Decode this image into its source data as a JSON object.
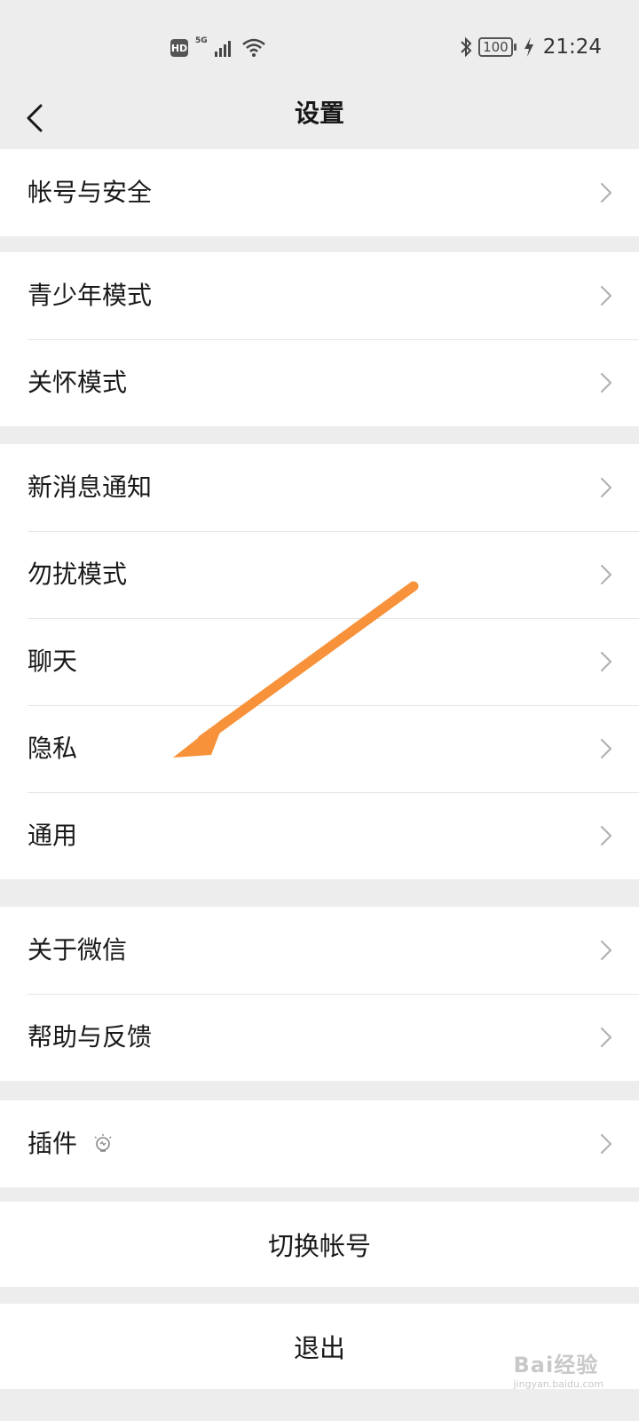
{
  "status_bar": {
    "hd": "HD",
    "network": "5G",
    "battery": "100",
    "time": "21:24"
  },
  "navbar": {
    "title": "设置"
  },
  "groups": [
    {
      "items": [
        {
          "label": "帐号与安全"
        }
      ]
    },
    {
      "items": [
        {
          "label": "青少年模式"
        },
        {
          "label": "关怀模式"
        }
      ]
    },
    {
      "items": [
        {
          "label": "新消息通知"
        },
        {
          "label": "勿扰模式"
        },
        {
          "label": "聊天"
        },
        {
          "label": "隐私"
        },
        {
          "label": "通用"
        }
      ]
    },
    {
      "items": [
        {
          "label": "关于微信"
        },
        {
          "label": "帮助与反馈"
        }
      ]
    },
    {
      "items": [
        {
          "label": "插件"
        }
      ]
    }
  ],
  "actions": {
    "switch_account": "切换帐号",
    "logout": "退出"
  },
  "annotation": {
    "arrow_color": "#f7923a"
  },
  "watermark": {
    "brand": "Bai经验",
    "url": "jingyan.baidu.com"
  },
  "icons": {
    "back": "chevron-left-icon",
    "row_chevron": "chevron-right-icon",
    "plugin_badge": "lightbulb-icon"
  }
}
